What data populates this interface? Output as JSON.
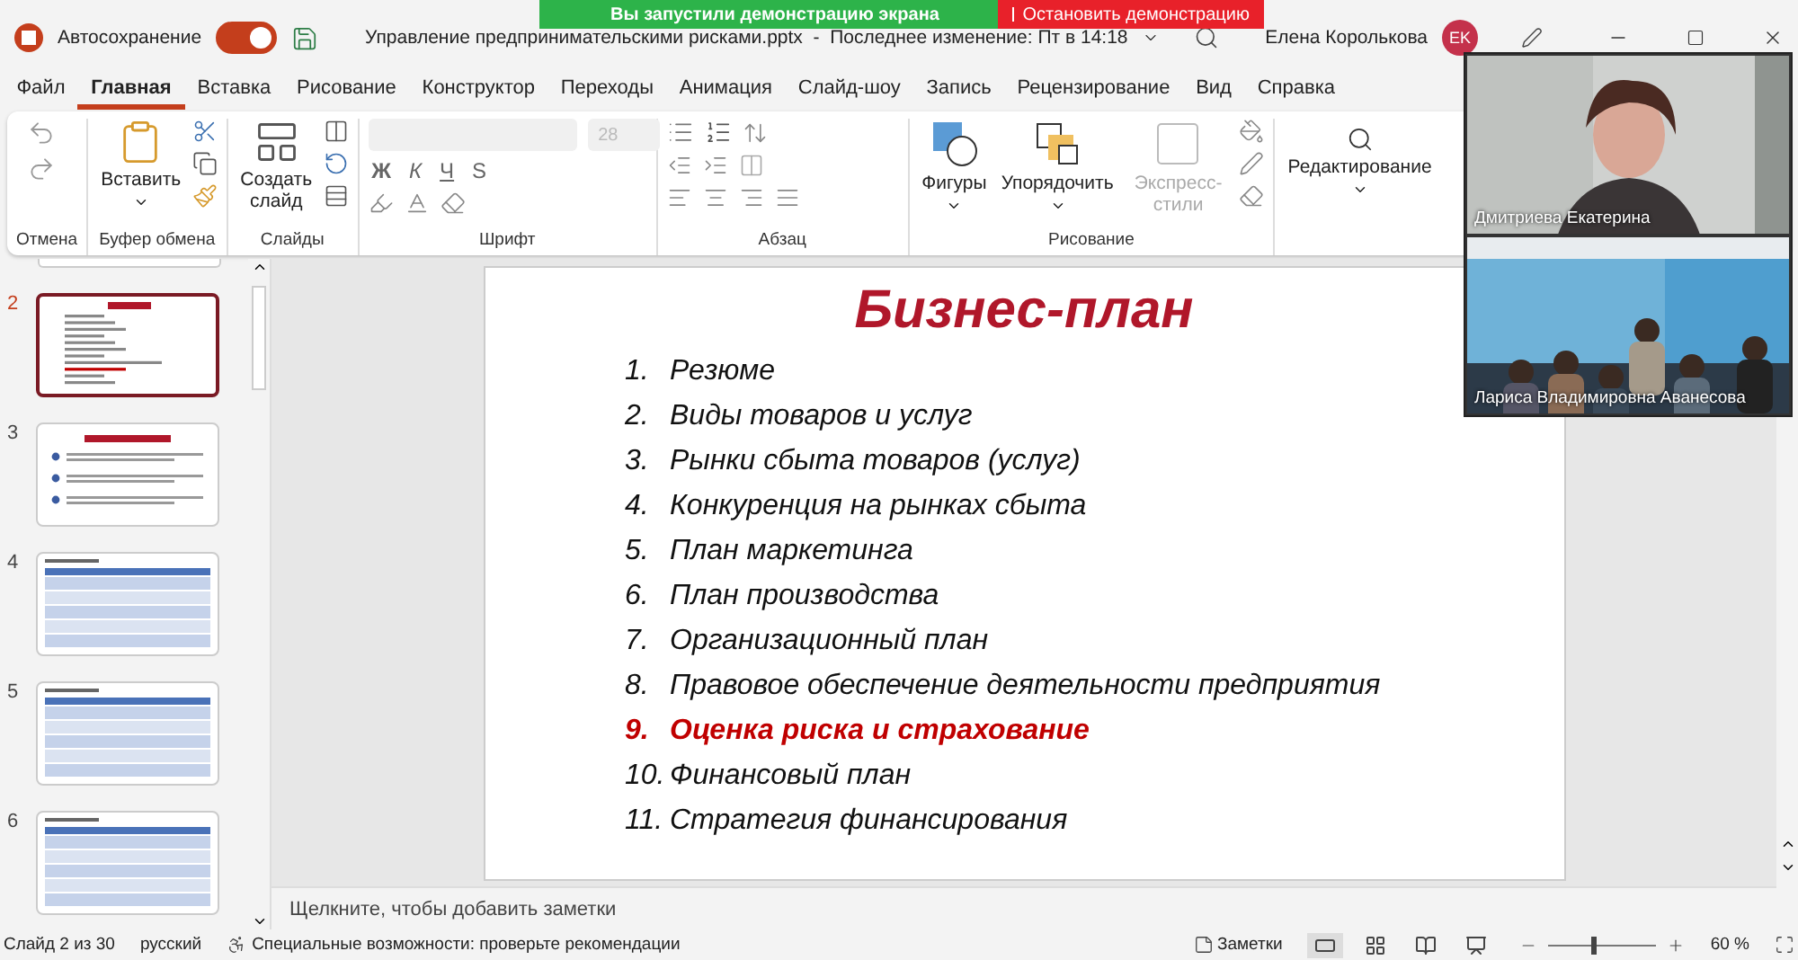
{
  "titlebar": {
    "autosave_label": "Автосохранение",
    "autosave_on": true,
    "document": "Управление предпринимательскими рисками.pptx  -  Последнее изменение: Пт в 14:18",
    "user": "Елена Королькова",
    "avatar": "EK"
  },
  "share_banner": {
    "message": "Вы запустили демонстрацию экрана",
    "stop": "Остановить демонстрацию"
  },
  "menu": [
    {
      "label": "Файл",
      "selected": false
    },
    {
      "label": "Главная",
      "selected": true
    },
    {
      "label": "Вставка",
      "selected": false
    },
    {
      "label": "Рисование",
      "selected": false
    },
    {
      "label": "Конструктор",
      "selected": false
    },
    {
      "label": "Переходы",
      "selected": false
    },
    {
      "label": "Анимация",
      "selected": false
    },
    {
      "label": "Слайд-шоу",
      "selected": false
    },
    {
      "label": "Запись",
      "selected": false
    },
    {
      "label": "Рецензирование",
      "selected": false
    },
    {
      "label": "Вид",
      "selected": false
    },
    {
      "label": "Справка",
      "selected": false
    }
  ],
  "ribbon": {
    "undo_group": "Отмена",
    "clipboard_group": "Буфер обмена",
    "paste": "Вставить",
    "slides_group": "Слайды",
    "new_slide": "Создать слайд",
    "font_group": "Шрифт",
    "font_size": "28",
    "font_buttons": [
      "Ж",
      "К",
      "Ч",
      "S"
    ],
    "paragraph_group": "Абзац",
    "drawing_group": "Рисование",
    "shapes": "Фигуры",
    "arrange": "Упорядочить",
    "quick_styles": {
      "label": "Экспресс-стили",
      "disabled": true
    },
    "editing": "Редактирование"
  },
  "thumbnails": [
    {
      "number": "2",
      "selected": true,
      "kind": "list"
    },
    {
      "number": "3",
      "selected": false,
      "kind": "bullets"
    },
    {
      "number": "4",
      "selected": false,
      "kind": "table"
    },
    {
      "number": "5",
      "selected": false,
      "kind": "table"
    },
    {
      "number": "6",
      "selected": false,
      "kind": "table"
    }
  ],
  "slide": {
    "title": "Бизнес-план",
    "items": [
      {
        "number": "1.",
        "text": "Резюме",
        "highlighted": false
      },
      {
        "number": "2.",
        "text": "Виды товаров и услуг",
        "highlighted": false
      },
      {
        "number": "3.",
        "text": "Рынки сбыта товаров (услуг)",
        "highlighted": false
      },
      {
        "number": "4.",
        "text": "Конкуренция на рынках сбыта",
        "highlighted": false
      },
      {
        "number": "5.",
        "text": "План маркетинга",
        "highlighted": false
      },
      {
        "number": "6.",
        "text": "План производства",
        "highlighted": false
      },
      {
        "number": "7.",
        "text": "Организационный план",
        "highlighted": false
      },
      {
        "number": "8.",
        "text": "Правовое обеспечение деятельности предприятия",
        "highlighted": false
      },
      {
        "number": "9.",
        "text": "Оценка риска и страхование",
        "highlighted": true
      },
      {
        "number": "10.",
        "text": "Финансовый план",
        "highlighted": false
      },
      {
        "number": "11.",
        "text": "Стратегия финансирования",
        "highlighted": false
      }
    ]
  },
  "notes_placeholder": "Щелкните, чтобы добавить заметки",
  "video": [
    {
      "name": "Дмитриева Екатерина",
      "kind": "single"
    },
    {
      "name": "Лариса Владимировна Аванесова",
      "kind": "room"
    }
  ],
  "status": {
    "slide": "Слайд 2 из 30",
    "language": "русский",
    "accessibility": "Специальные возможности: проверьте рекомендации",
    "notes": "Заметки",
    "zoom": "60 %",
    "level": 0.4
  }
}
